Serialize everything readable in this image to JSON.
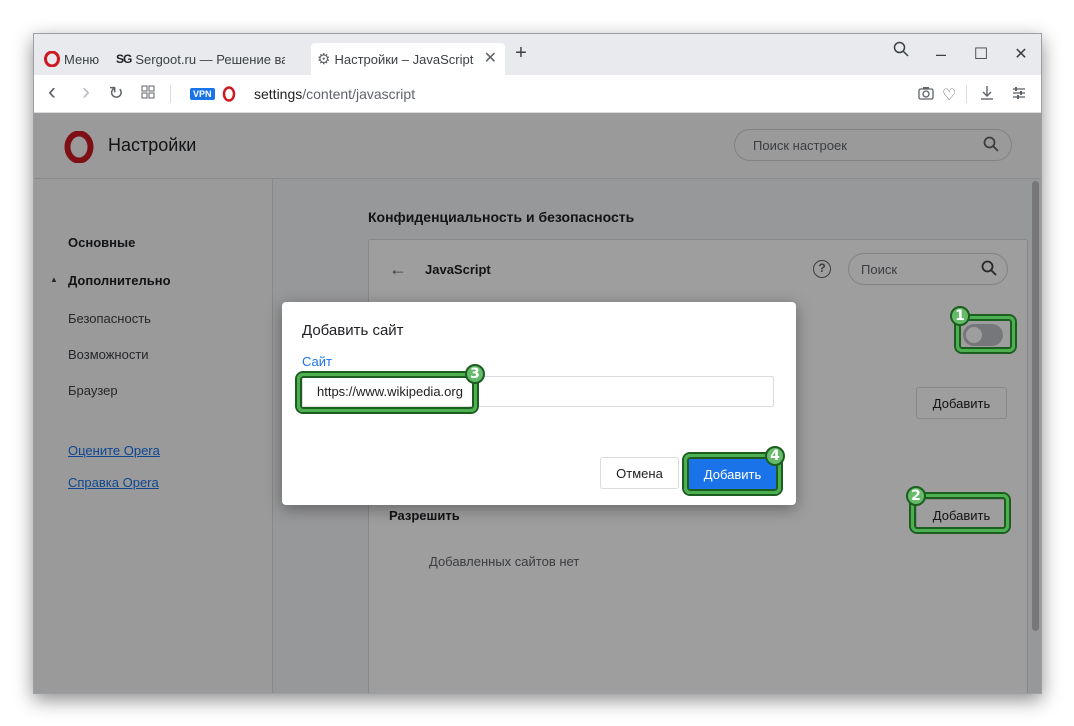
{
  "tabs": [
    {
      "label": "Меню"
    },
    {
      "label": "Sergoot.ru — Решение ваш"
    },
    {
      "label": "Настройки – JavaScript"
    }
  ],
  "icons": {
    "new_tab": "+",
    "minimize": "–",
    "maximize": "☐",
    "close": "✕",
    "back": "‹",
    "forward": "›",
    "reload": "↻",
    "search": "search-icon"
  },
  "address": {
    "vpn": "VPN",
    "url_host": "settings",
    "url_path": "/content/javascript"
  },
  "settings": {
    "title": "Настройки",
    "search_placeholder": "Поиск настроек"
  },
  "sidebar": {
    "items": [
      {
        "label": "Основные"
      },
      {
        "label": "Дополнительно"
      },
      {
        "label": "Безопасность"
      },
      {
        "label": "Возможности"
      },
      {
        "label": "Браузер"
      }
    ],
    "links": [
      {
        "label": "Оцените Opera"
      },
      {
        "label": "Справка Opera"
      }
    ]
  },
  "main": {
    "section_title": "Конфиденциальность и безопасность",
    "page_title": "JavaScript",
    "search_placeholder": "Поиск",
    "add_label": "Добавить",
    "allow_label": "Разрешить",
    "no_sites": "Добавленных сайтов нет"
  },
  "dialog": {
    "title": "Добавить сайт",
    "field_label": "Сайт",
    "field_value": "https://www.wikipedia.org",
    "cancel": "Отмена",
    "add": "Добавить"
  },
  "annotations": [
    "1",
    "2",
    "3",
    "4"
  ],
  "colors": {
    "accent": "#1a73e8",
    "highlight": "#4caf50",
    "opera_red": "#cc1b22"
  }
}
